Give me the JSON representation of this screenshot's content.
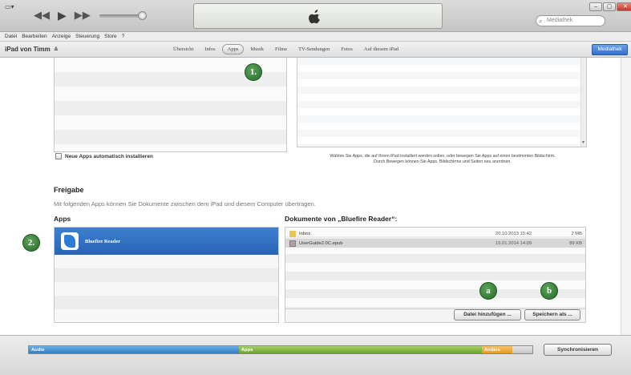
{
  "window": {
    "menu_button": "▭▾",
    "search_placeholder": "Mediathek",
    "controls": {
      "minimize": "–",
      "maximize": "▢",
      "close": "✕"
    }
  },
  "menubar": {
    "items": [
      "Datei",
      "Bearbeiten",
      "Anzeige",
      "Steuerung",
      "Store",
      "?"
    ]
  },
  "device": {
    "name": "iPad von Timm",
    "eject": "≙"
  },
  "tabs": [
    {
      "label": "Übersicht",
      "active": false
    },
    {
      "label": "Infos",
      "active": false
    },
    {
      "label": "Apps",
      "active": true
    },
    {
      "label": "Musik",
      "active": false
    },
    {
      "label": "Filme",
      "active": false
    },
    {
      "label": "TV-Sendungen",
      "active": false
    },
    {
      "label": "Fotos",
      "active": false
    },
    {
      "label": "Auf diesem iPad",
      "active": false
    }
  ],
  "library_button": "Mediathek",
  "auto_install": {
    "label": "Neue Apps automatisch installieren"
  },
  "screens_hint": {
    "line1": "Wählen Sie Apps, die auf Ihrem iPad installiert werden sollen, oder bewegen Sie Apps auf einen bestimmten Bildschirm.",
    "line2": "Durch Bewegen können Sie Apps, Bildschirme und Seiten neu anordnen."
  },
  "sharing": {
    "title": "Freigabe",
    "description": "Mit folgenden Apps können Sie Dokumente zwischen dem iPad und diesem Computer übertragen.",
    "apps_header": "Apps",
    "docs_header": "Dokumente von „Bluefire Reader“:",
    "apps": [
      {
        "name": "Bluefire Reader"
      }
    ],
    "documents": [
      {
        "name": "Inbox",
        "date": "20.10.2013 15:42",
        "size": "2 MB",
        "type": "folder"
      },
      {
        "name": "UserGuide2.0C.epub",
        "date": "15.01.2014 14:09",
        "size": "89 KB",
        "type": "file"
      }
    ],
    "add_file_button": "Datei hinzufügen ...",
    "save_as_button": "Speichern als ..."
  },
  "callouts": {
    "one": "1.",
    "two": "2.",
    "a": "a",
    "b": "b"
  },
  "capacity": {
    "audio": "Audio",
    "apps": "Apps",
    "other": "Andere"
  },
  "sync_button": "Synchronisieren"
}
